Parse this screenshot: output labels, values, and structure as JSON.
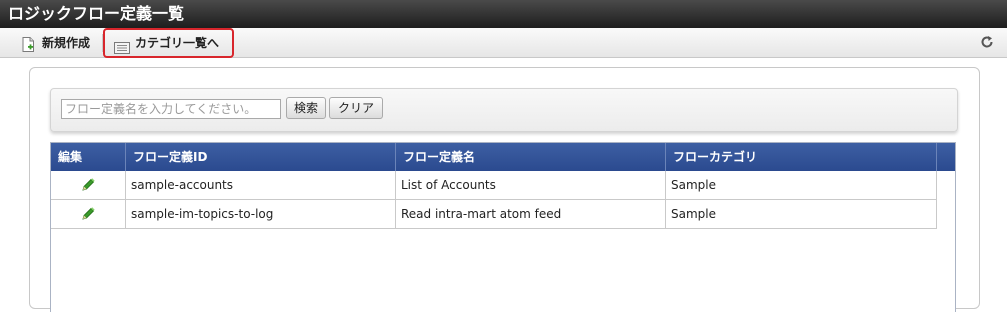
{
  "window": {
    "title": "ロジックフロー定義一覧"
  },
  "toolbar": {
    "new_label": "新規作成",
    "category_label": "カテゴリ一覧へ",
    "reload_icon": "reload-icon"
  },
  "search": {
    "placeholder": "フロー定義名を入力してください。",
    "value": "",
    "search_label": "検索",
    "clear_label": "クリア"
  },
  "grid": {
    "columns": [
      "編集",
      "フロー定義ID",
      "フロー定義名",
      "フローカテゴリ"
    ],
    "rows": [
      {
        "id": "sample-accounts",
        "name": "List of Accounts",
        "category": "Sample"
      },
      {
        "id": "sample-im-topics-to-log",
        "name": "Read intra-mart atom feed",
        "category": "Sample"
      }
    ]
  },
  "colors": {
    "header_blue": "#2b4a8f",
    "highlight_red": "#d8262c",
    "edit_green": "#3a9a2a"
  }
}
